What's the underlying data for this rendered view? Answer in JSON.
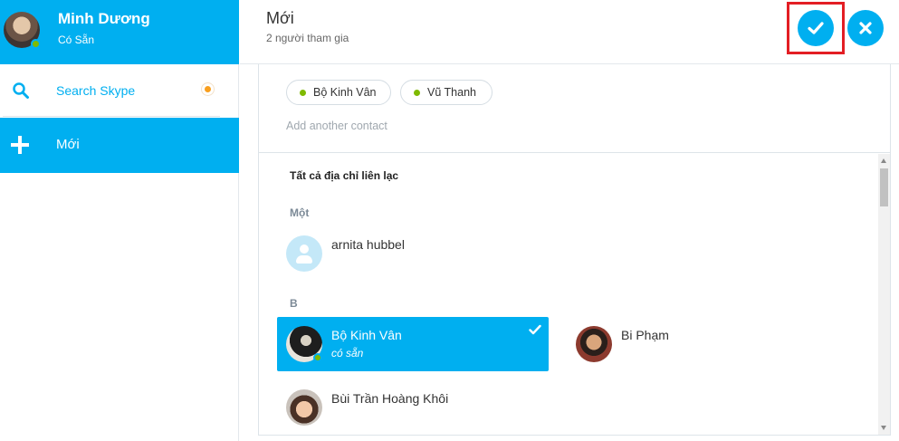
{
  "profile": {
    "name": "Minh Dương",
    "status": "Có Sẵn"
  },
  "sidebar": {
    "search_label": "Search Skype",
    "new_label": "Mới"
  },
  "header": {
    "title": "Mới",
    "subtitle": "2 người tham gia"
  },
  "selected_chips": [
    {
      "label": "Bộ Kinh Vân"
    },
    {
      "label": "Vũ Thanh"
    }
  ],
  "add_contact_placeholder": "Add another contact",
  "contacts": {
    "section_title": "Tất cả địa chỉ liên lạc",
    "groups": [
      {
        "label": "Một",
        "items": [
          {
            "name": "arnita hubbel"
          }
        ]
      },
      {
        "label": "B",
        "items": [
          {
            "name": "Bộ Kinh Vân",
            "status": "có sẵn",
            "selected": true
          },
          {
            "name": "Bi Phạm"
          },
          {
            "name": "Bùi Trần Hoàng Khôi"
          }
        ]
      }
    ]
  },
  "colors": {
    "accent": "#00aff0",
    "presence": "#7fba00",
    "highlight_border": "#e31e24",
    "notification": "#f99f1e"
  }
}
